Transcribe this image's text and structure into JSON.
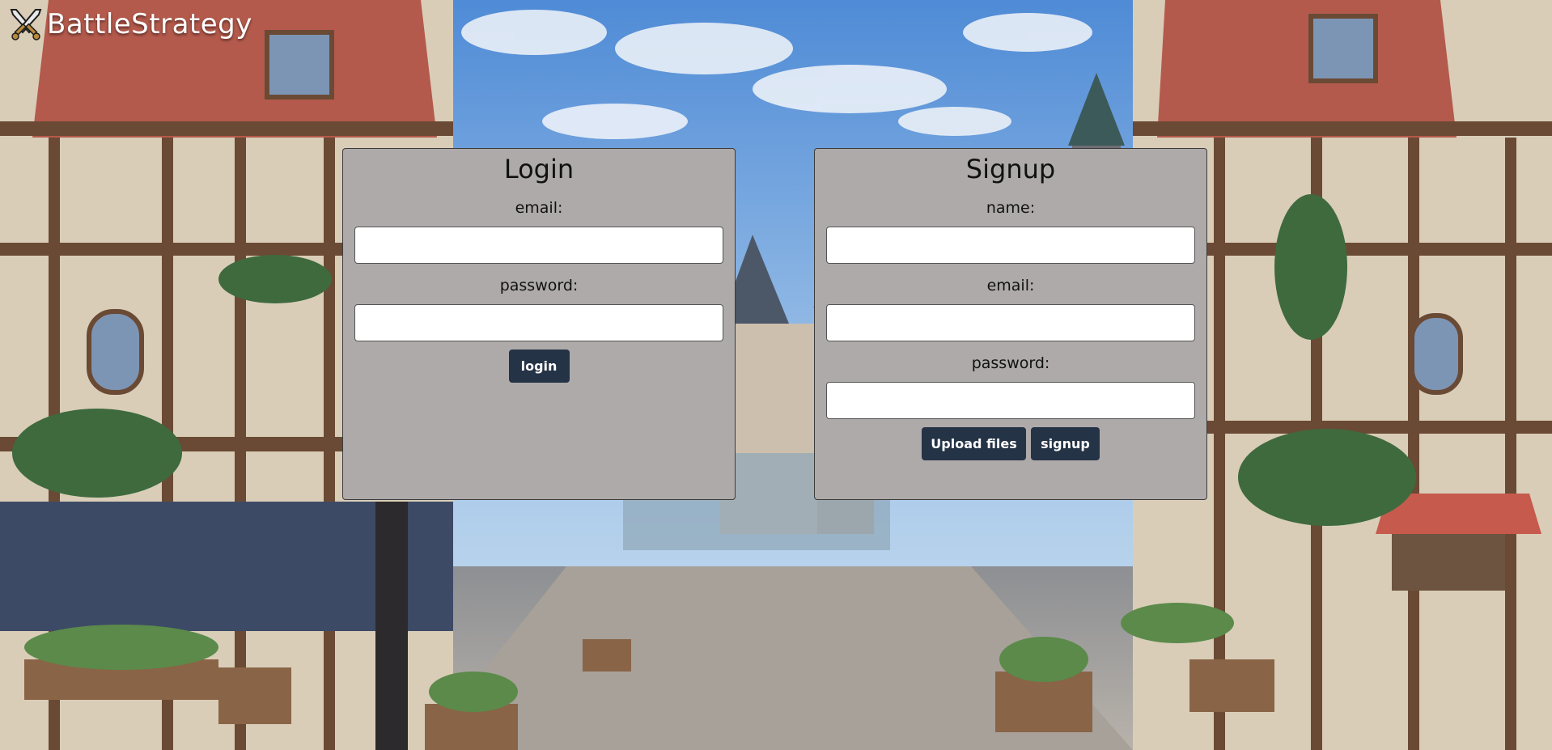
{
  "app": {
    "title": "BattleStrategy",
    "logo_icon": "crossed-swords-icon"
  },
  "login": {
    "title": "Login",
    "email_label": "email:",
    "email_value": "",
    "password_label": "password:",
    "password_value": "",
    "submit_label": "login"
  },
  "signup": {
    "title": "Signup",
    "name_label": "name:",
    "name_value": "",
    "email_label": "email:",
    "email_value": "",
    "password_label": "password:",
    "password_value": "",
    "upload_label": "Upload files",
    "submit_label": "signup"
  },
  "colors": {
    "panel_bg": "#aeaaaa",
    "button_bg": "#253346",
    "button_text": "#ffffff",
    "sky_top": "#4f8bd6",
    "roof": "#b45a4c"
  }
}
